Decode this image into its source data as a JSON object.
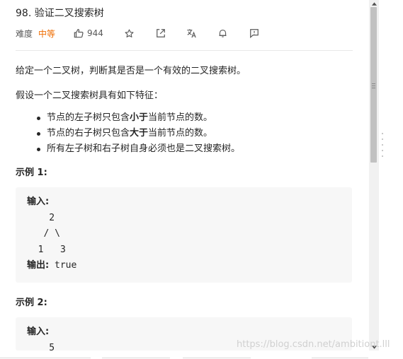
{
  "problem": {
    "title": "98. 验证二叉搜索树",
    "difficulty_label": "难度",
    "difficulty_value": "中等",
    "likes": "944"
  },
  "toolbar": {
    "icons": [
      "thumbs-up-icon",
      "star-icon",
      "share-icon",
      "translate-icon",
      "bell-icon",
      "feedback-icon"
    ]
  },
  "description": {
    "intro": "给定一个二叉树，判断其是否是一个有效的二叉搜索树。",
    "assumption": "假设一个二叉搜索树具有如下特征：",
    "features": [
      {
        "prefix": "节点的左子树只包含",
        "emphasis": "小于",
        "suffix": "当前节点的数。"
      },
      {
        "prefix": "节点的右子树只包含",
        "emphasis": "大于",
        "suffix": "当前节点的数。"
      },
      {
        "text": "所有左子树和右子树自身必须也是二叉搜索树。"
      }
    ]
  },
  "examples": [
    {
      "heading": "示例 1:",
      "input_label": "输入:",
      "tree_lines": [
        "    2",
        "   / \\",
        "  1   3"
      ],
      "output_label": "输出:",
      "output_value": "true"
    },
    {
      "heading": "示例 2:",
      "input_label": "输入:",
      "tree_lines": [
        "    5"
      ]
    }
  ],
  "watermark": "https://blog.csdn.net/ambitiont.lll",
  "colors": {
    "difficulty_medium": "#ef6c00",
    "code_bg": "#f7f7f7",
    "divider": "#e8e8e8"
  }
}
